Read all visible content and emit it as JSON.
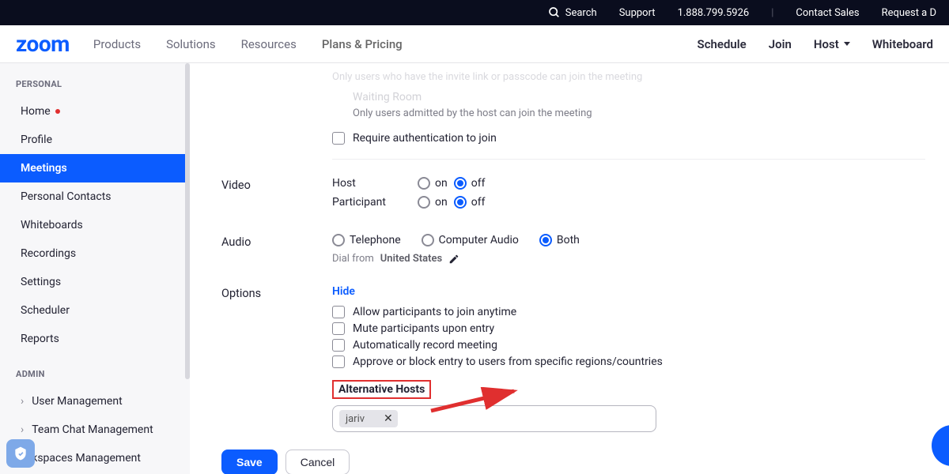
{
  "topbar": {
    "search": "Search",
    "support": "Support",
    "phone": "1.888.799.5926",
    "contact": "Contact Sales",
    "request": "Request a D"
  },
  "header": {
    "logo": "zoom",
    "nav": [
      "Products",
      "Solutions",
      "Resources",
      "Plans & Pricing"
    ],
    "right": {
      "schedule": "Schedule",
      "join": "Join",
      "host": "Host",
      "whiteboard": "Whiteboard"
    }
  },
  "sidebar": {
    "personal_title": "PERSONAL",
    "admin_title": "ADMIN",
    "items": {
      "home": "Home",
      "profile": "Profile",
      "meetings": "Meetings",
      "contacts": "Personal Contacts",
      "whiteboards": "Whiteboards",
      "recordings": "Recordings",
      "settings": "Settings",
      "scheduler": "Scheduler",
      "reports": "Reports",
      "user_mgmt": "User Management",
      "chat_mgmt": "Team Chat Management",
      "workspaces_mgmt": "kspaces Management"
    }
  },
  "form": {
    "faded_security_desc": "Only users who have the invite link or passcode can join the meeting",
    "waiting_room": "Waiting Room",
    "waiting_room_desc": "Only users admitted by the host can join the meeting",
    "require_auth": "Require authentication to join",
    "video_label": "Video",
    "host_label": "Host",
    "participant_label": "Participant",
    "on": "on",
    "off": "off",
    "audio_label": "Audio",
    "telephone": "Telephone",
    "computer_audio": "Computer Audio",
    "both": "Both",
    "dial_prefix": "Dial from",
    "dial_country": "United States",
    "options_label": "Options",
    "hide": "Hide",
    "opt_allow_join": "Allow participants to join anytime",
    "opt_mute": "Mute participants upon entry",
    "opt_record": "Automatically record meeting",
    "opt_region": "Approve or block entry to users from specific regions/countries",
    "alt_hosts": "Alternative Hosts",
    "alt_chip": "jariv",
    "save": "Save",
    "cancel": "Cancel"
  }
}
